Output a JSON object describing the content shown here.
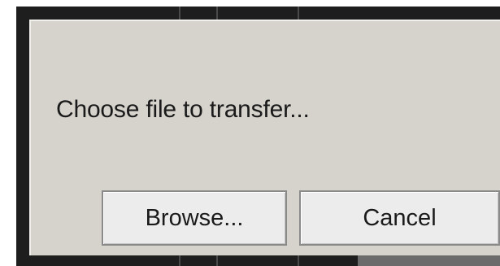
{
  "dialog": {
    "message": "Choose file to transfer...",
    "buttons": {
      "browse_label": "Browse...",
      "cancel_label": "Cancel"
    }
  },
  "colors": {
    "dialog_background": "#d6d2cc",
    "button_background": "#ececec",
    "backdrop": "#1e1e1e"
  }
}
